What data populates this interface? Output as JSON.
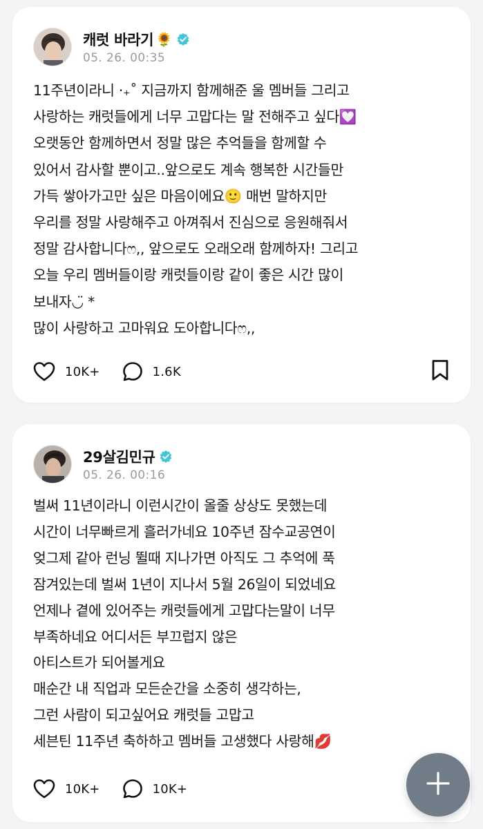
{
  "posts": [
    {
      "author": "캐럿 바라기",
      "author_emoji": "🌻",
      "verified_icon": "verified-check-icon",
      "timestamp": "05. 26. 00:35",
      "body": "11주년이라니 ‧₊˚ 지금까지 함께해준 울 멤버들 그리고\n사랑하는 캐럿들에게 너무 고맙다는 말 전해주고 싶다💟\n오랫동안 함께하면서 정말 많은 추억들을 함께할 수\n있어서 감사할 뿐이고..앞으로도 계속 행복한 시간들만\n가득 쌓아가고만 싶은 마음이에요🙂 매번 말하지만\n우리를 정말 사랑해주고 아껴줘서 진심으로 응원해줘서\n정말 감사합니다ෆ,, 앞으로도 오래오래 함께하자! 그리고\n오늘 우리 멤버들이랑 캐럿들이랑 같이 좋은 시간 많이\n보내자◡̈ *\n많이 사랑하고 고마워요 도아합니다ෆ,,",
      "likes": "10K+",
      "comments": "1.6K",
      "has_bookmark": true
    },
    {
      "author": "29살김민규",
      "author_emoji": "",
      "verified_icon": "verified-check-icon",
      "timestamp": "05. 26. 00:16",
      "body": "벌써 11년이라니 이런시간이 올줄 상상도 못했는데\n시간이 너무빠르게 흘러가네요 10주년 잠수교공연이\n엊그제 같아 런닝 뛸때 지나가면 아직도 그 추억에 푹\n잠겨있는데 벌써 1년이 지나서 5월 26일이 되었네요\n언제나 곁에 있어주는 캐럿들에게 고맙다는말이 너무\n부족하네요 어디서든 부끄럽지 않은\n아티스트가 되어볼게요\n매순간 내 직업과 모든순간을 소중히 생각하는,\n그런 사람이 되고싶어요 캐럿들 고맙고\n세븐틴 11주년 축하하고 멤버들 고생했다 사랑해💋",
      "likes": "10K+",
      "comments": "10K+",
      "has_bookmark": false
    }
  ],
  "colors": {
    "background": "#f4f4f6",
    "card": "#ffffff",
    "verified": "#3ec7dc",
    "timestamp": "#9a9a9a",
    "fab": "#707d89"
  },
  "fab": {
    "icon": "plus-icon"
  }
}
